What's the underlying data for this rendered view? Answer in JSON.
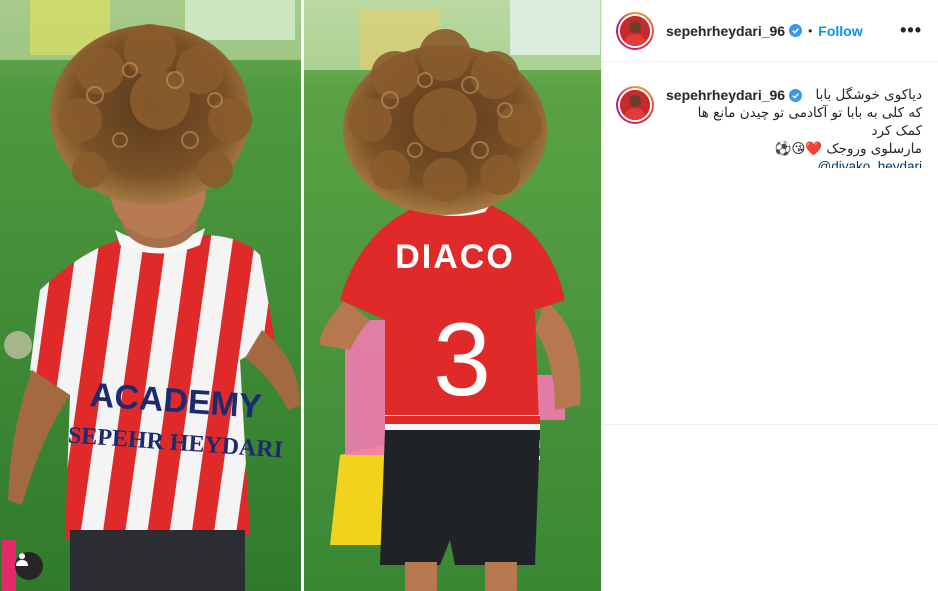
{
  "post": {
    "username": "sepehrheydari_96",
    "separator": "•",
    "follow_label": "Follow",
    "more_icon": "•••",
    "caption_lines": [
      "دیاکوی خوشگل بابا",
      "که کلی به بابا تو آکادمی تو چیدن مانع ها",
      "کمک کرد",
      "مارسلوی وروجک ❤️😘⚽"
    ],
    "mention": "@diyako_heydari",
    "verified_icon": "verified-badge-icon"
  },
  "photo": {
    "left_shirt_text_1": "ACADEMY",
    "left_shirt_text_2": "SEPEHR HEYDARI",
    "right_shirt_name": "DIACO",
    "right_shirt_number": "3"
  },
  "colors": {
    "accent": "#0095f6",
    "jersey_red": "#e02a2a",
    "grass": "#3f8a37"
  }
}
